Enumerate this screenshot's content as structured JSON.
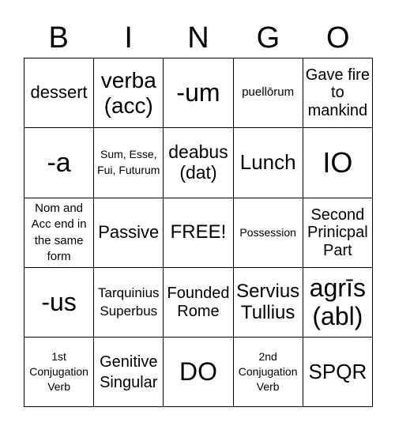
{
  "header": [
    "B",
    "I",
    "N",
    "G",
    "O"
  ],
  "cells": [
    [
      "dessert",
      "verba (acc)",
      "-um",
      "puellōrum",
      "Gave fire to mankind"
    ],
    [
      "-a",
      "Sum, Esse, Fui, Futurum",
      "deabus (dat)",
      "Lunch",
      "IO"
    ],
    [
      "Nom and Acc end in the same form",
      "Passive",
      "FREE!",
      "Possession",
      "Second Prinicpal Part"
    ],
    [
      "-us",
      "Tarquinius Superbus",
      "Founded Rome",
      "Servius Tullius",
      "agrīs (abl)"
    ],
    [
      "1st Conjugation Verb",
      "Genitive Singular",
      "DO",
      "2nd Conjugation Verb",
      "SPQR"
    ]
  ]
}
